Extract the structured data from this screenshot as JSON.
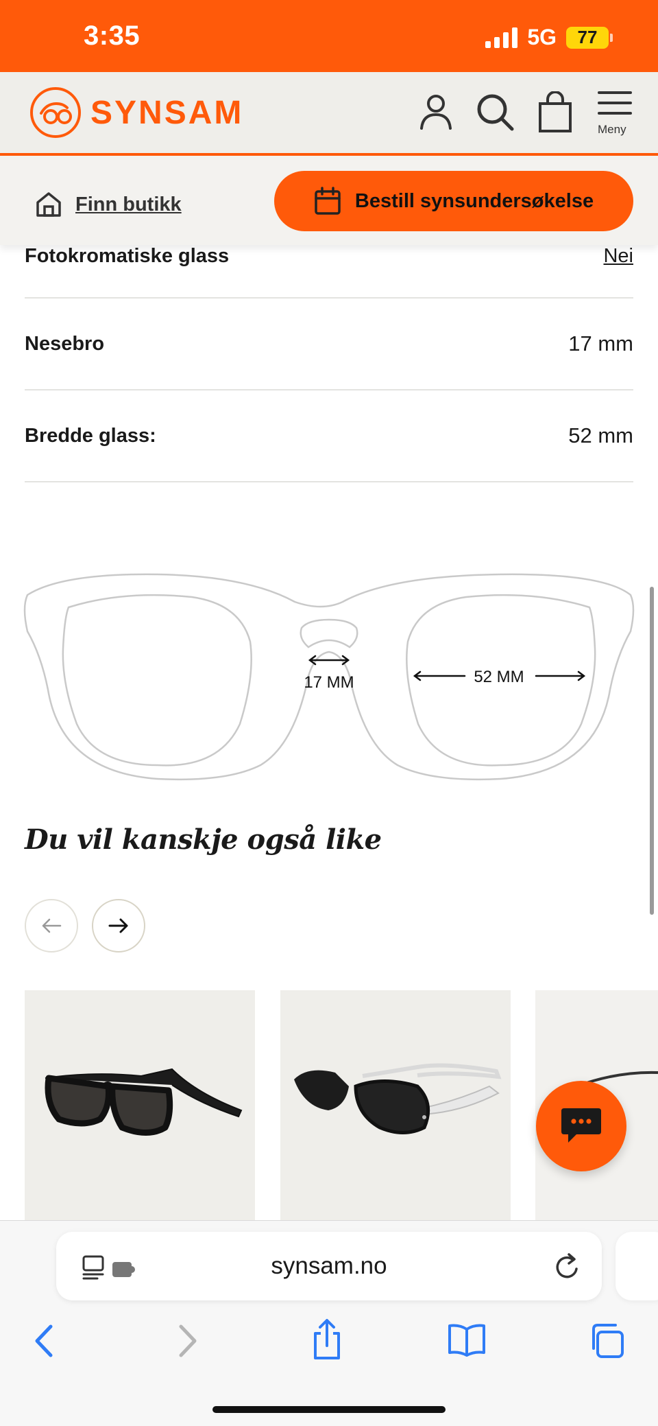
{
  "status_bar": {
    "time": "3:35",
    "network": "5G",
    "battery": "77"
  },
  "header": {
    "brand": "SYNSAM",
    "menu_label": "Meny"
  },
  "actions": {
    "find_store": "Finn butikk",
    "book_exam": "Bestill synsundersøkelse"
  },
  "specs": [
    {
      "label": "Fotokromatiske glass",
      "value": "Nei"
    },
    {
      "label": "Nesebro",
      "value": "17 mm"
    },
    {
      "label": "Bredde glass:",
      "value": "52 mm"
    }
  ],
  "diagram": {
    "bridge_label": "17 MM",
    "lens_label": "52 MM"
  },
  "recommendations": {
    "title": "Du vil kanskje også like"
  },
  "browser": {
    "url": "synsam.no"
  },
  "colors": {
    "brand": "#ff5a0a",
    "header_bg": "#efeeea",
    "ios_blue": "#2f7cf6"
  }
}
